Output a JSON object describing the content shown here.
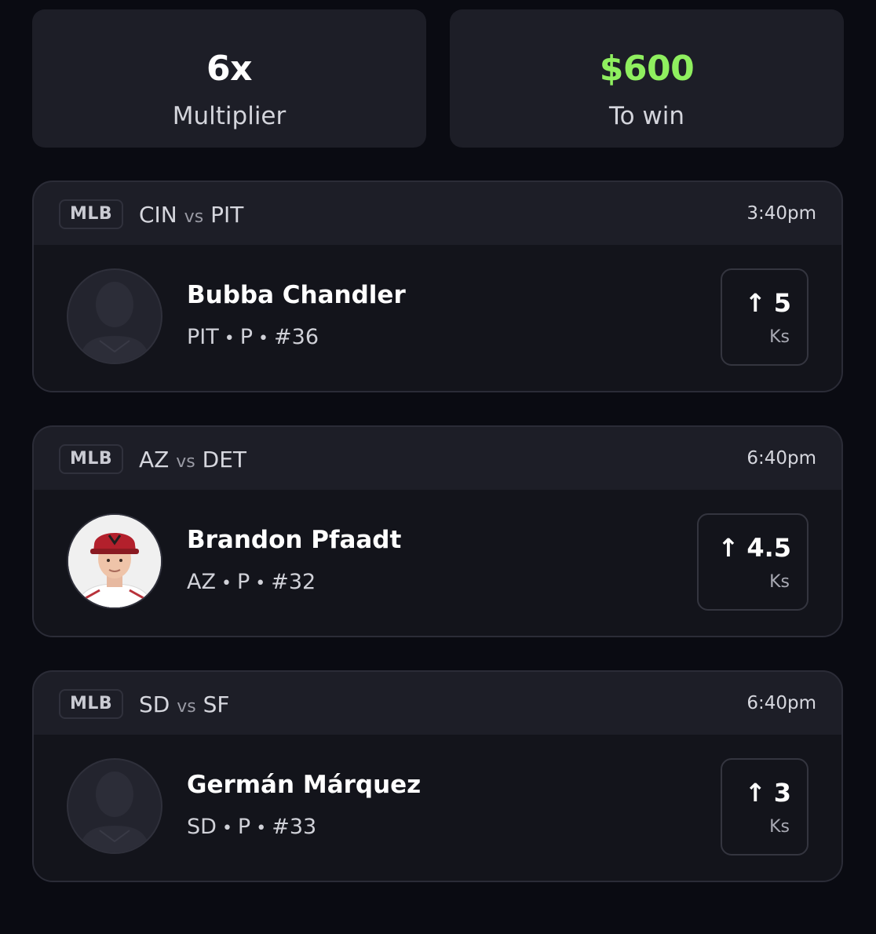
{
  "summary": {
    "multiplier_value": "6x",
    "multiplier_label": "Multiplier",
    "to_win_value": "$600",
    "to_win_label": "To win",
    "to_win_color": "#8fef5f"
  },
  "picks": [
    {
      "league": "MLB",
      "team_a": "CIN",
      "vs": "vs",
      "team_b": "PIT",
      "time": "3:40pm",
      "player_name": "Bubba Chandler",
      "team": "PIT",
      "position": "P",
      "number": "#36",
      "separator": "•",
      "direction_icon": "arrow-up-icon",
      "arrow": "↑",
      "line": "5",
      "stat_unit": "Ks",
      "avatar": "placeholder-silhouette"
    },
    {
      "league": "MLB",
      "team_a": "AZ",
      "vs": "vs",
      "team_b": "DET",
      "time": "6:40pm",
      "player_name": "Brandon Pfaadt",
      "team": "AZ",
      "position": "P",
      "number": "#32",
      "separator": "•",
      "direction_icon": "arrow-up-icon",
      "arrow": "↑",
      "line": "4.5",
      "stat_unit": "Ks",
      "avatar": "player-headshot"
    },
    {
      "league": "MLB",
      "team_a": "SD",
      "vs": "vs",
      "team_b": "SF",
      "time": "6:40pm",
      "player_name": "Germán Márquez",
      "team": "SD",
      "position": "P",
      "number": "#33",
      "separator": "•",
      "direction_icon": "arrow-up-icon",
      "arrow": "↑",
      "line": "3",
      "stat_unit": "Ks",
      "avatar": "placeholder-silhouette"
    }
  ]
}
